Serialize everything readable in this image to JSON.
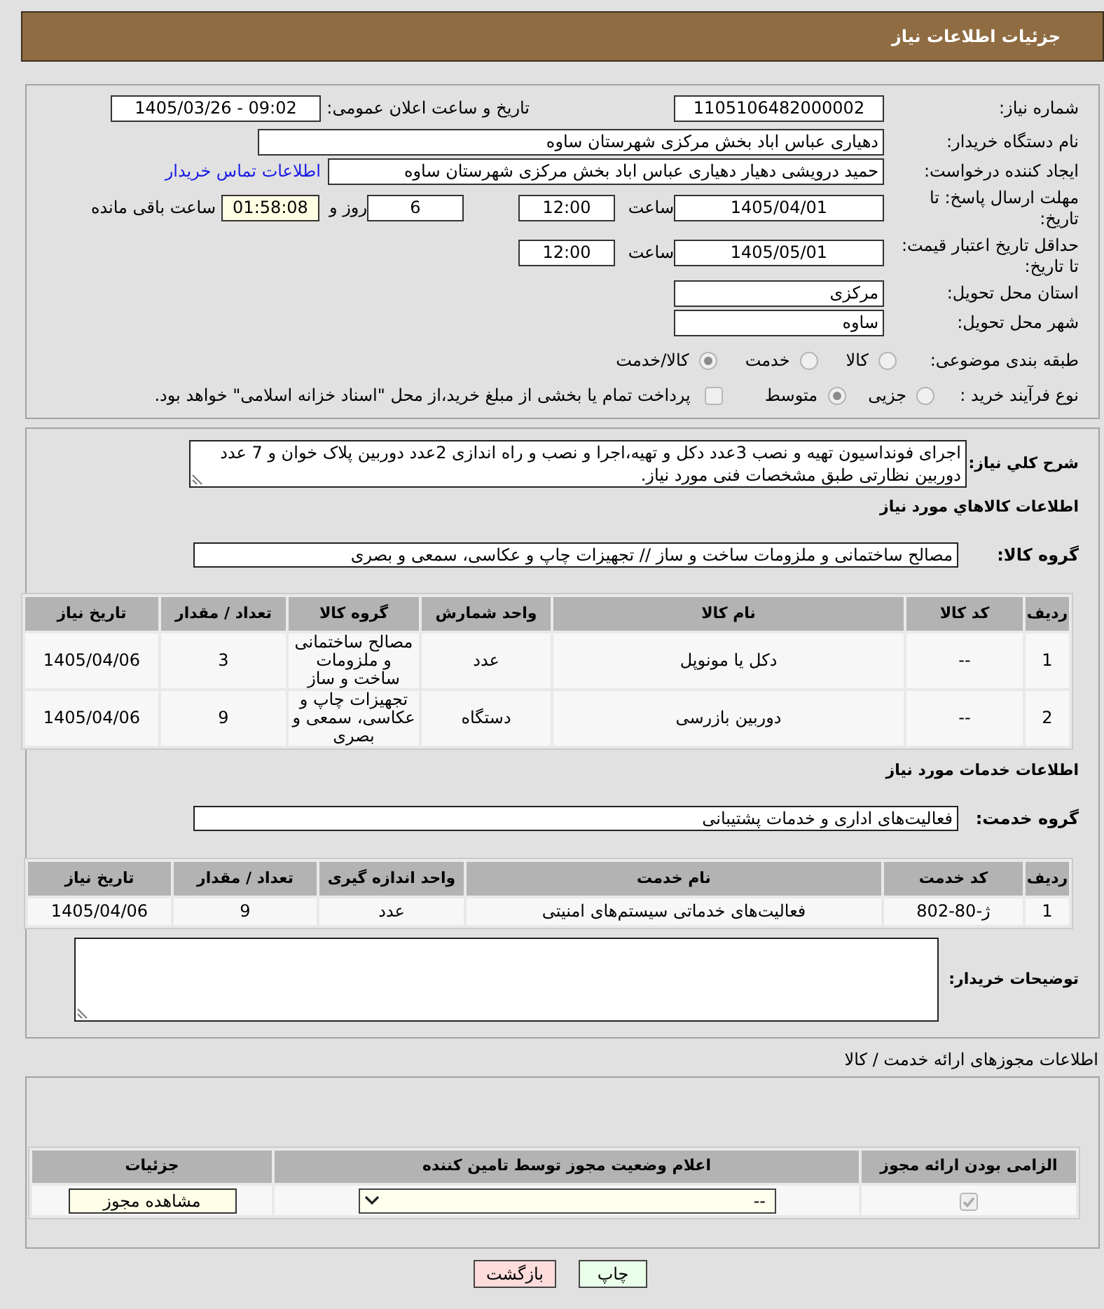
{
  "header": {
    "title": "جزئیات اطلاعات نیاز"
  },
  "summary": {
    "need_number": {
      "label": "شماره نیاز:",
      "value": "1105106482000002"
    },
    "announce_date": {
      "label": "تاریخ و ساعت اعلان عمومی:",
      "value": "1405/03/26 - 09:02"
    },
    "buyer_org": {
      "label": "نام دستگاه خریدار:",
      "value": "دهیاری عباس اباد بخش مرکزی شهرستان ساوه"
    },
    "requester": {
      "label": "ایجاد کننده درخواست:",
      "value": "حمید درویشی دهیار دهیاری عباس اباد بخش مرکزی شهرستان ساوه",
      "contact_link": "اطلاعات تماس خریدار"
    },
    "response_deadline": {
      "label": "مهلت ارسال پاسخ: تا تاریخ:",
      "date": "1405/04/01",
      "time_label": "ساعت",
      "time": "12:00",
      "days": "6",
      "days_label": "روز و",
      "remaining": "01:58:08",
      "remaining_label": "ساعت باقی مانده"
    },
    "price_validity": {
      "label": "حداقل تاریخ اعتبار قیمت: تا تاریخ:",
      "date": "1405/05/01",
      "time_label": "ساعت",
      "time": "12:00"
    },
    "delivery_province": {
      "label": "استان محل تحویل:",
      "value": "مرکزی"
    },
    "delivery_city": {
      "label": "شهر محل تحویل:",
      "value": "ساوه"
    },
    "subject_category": {
      "label": "طبقه بندی موضوعی:",
      "options": [
        {
          "label": "کالا",
          "selected": false
        },
        {
          "label": "خدمت",
          "selected": false
        },
        {
          "label": "کالا/خدمت",
          "selected": true
        }
      ]
    },
    "purchase_process": {
      "label": "نوع فرآیند خرید :",
      "options": [
        {
          "label": "جزیی",
          "selected": false
        },
        {
          "label": "متوسط",
          "selected": true
        }
      ],
      "treasury_option": {
        "label": "پرداخت تمام یا بخشی از مبلغ خرید،از محل \"اسناد خزانه اسلامی\" خواهد بود.",
        "checked": false
      }
    }
  },
  "requirements": {
    "description": {
      "label": "شرح کلي نياز:",
      "value": "اجرای فونداسیون تهیه و نصب 3عدد دکل و تهیه،اجرا و نصب و راه اندازی 2عدد دوربین پلاک خوان و 7 عدد دوربین نظارتی طبق مشخصات فنی مورد نیاز."
    },
    "goods_heading": "اطلاعات کالاهاي مورد نياز",
    "goods_group": {
      "label": "گروه کالا:",
      "value": "مصالح ساختمانی و ملزومات ساخت و ساز // تجهیزات چاپ و عکاسی، سمعی و بصری"
    },
    "goods_table": {
      "columns": [
        "ردیف",
        "کد کالا",
        "نام کالا",
        "واحد شمارش",
        "گروه کالا",
        "تعداد / مقدار",
        "تاریخ نیاز"
      ],
      "rows": [
        [
          "1",
          "--",
          "دکل یا مونوپل",
          "عدد",
          "مصالح ساختمانی و ملزومات ساخت و ساز",
          "3",
          "1405/04/06"
        ],
        [
          "2",
          "--",
          "دوربین بازرسی",
          "دستگاه",
          "تجهیزات چاپ و عکاسی، سمعی و بصری",
          "9",
          "1405/04/06"
        ]
      ]
    },
    "services_heading": "اطلاعات خدمات مورد نیاز",
    "service_group": {
      "label": "گروه خدمت:",
      "value": "فعالیت‌های اداری و خدمات پشتیبانی"
    },
    "services_table": {
      "columns": [
        "ردیف",
        "کد خدمت",
        "نام خدمت",
        "واحد اندازه گیری",
        "تعداد / مقدار",
        "تاریخ نیاز"
      ],
      "rows": [
        [
          "1",
          "ژ-80-802",
          "فعالیت‌های خدماتی سیستم‌های امنیتی",
          "عدد",
          "9",
          "1405/04/06"
        ]
      ]
    },
    "buyer_notes": {
      "label": "توضیحات خریدار:"
    }
  },
  "permits": {
    "heading": "اطلاعات مجوزهای ارائه خدمت / کالا",
    "table": {
      "columns": [
        "الزامی بودن ارائه مجوز",
        "اعلام وضعیت مجوز توسط تامین کننده",
        "جزئیات"
      ],
      "rows": [
        {
          "required": true,
          "status": "--",
          "details_button": "مشاهده مجوز"
        }
      ]
    }
  },
  "buttons": [
    {
      "label": "چاپ",
      "kind": "print"
    },
    {
      "label": "بازگشت",
      "kind": "back"
    }
  ]
}
